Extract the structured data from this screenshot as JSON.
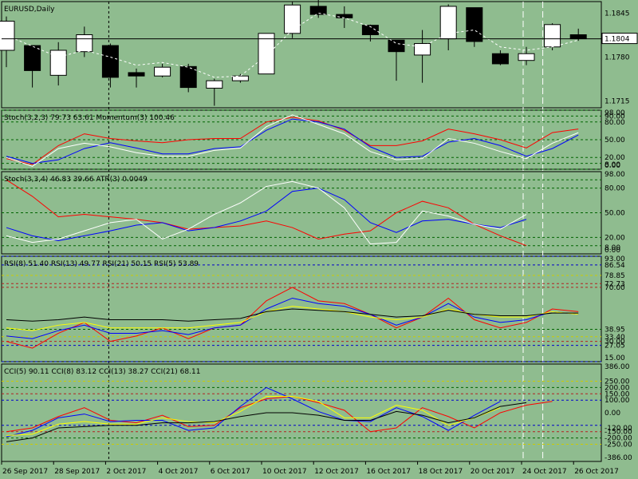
{
  "colors": {
    "background": "#8fbc8f",
    "frame": "#000000",
    "candle_bull": "#ffffff",
    "candle_bear": "#000000",
    "line_red": "#ff0000",
    "line_blue": "#0000ff",
    "line_white": "#ffffff",
    "line_yellow": "#ffff00",
    "line_black": "#000000",
    "level_green": "#006400",
    "level_blue": "#0000cd",
    "level_red": "#b22222",
    "level_yellow": "#cccc00"
  },
  "chart_data": [
    {
      "type": "candlestick",
      "title": "EURUSD,Daily",
      "price_label": "1.1804",
      "ylim": [
        1.1705,
        1.1862
      ],
      "y_ticks": [
        "1.1845",
        "1.1804",
        "1.1780",
        "1.1715"
      ],
      "y_tick_values": [
        1.1845,
        1.1804,
        1.178,
        1.1715
      ],
      "candles": [
        {
          "o": 1.179,
          "h": 1.184,
          "l": 1.1765,
          "c": 1.1833
        },
        {
          "o": 1.1797,
          "h": 1.1795,
          "l": 1.1735,
          "c": 1.176
        },
        {
          "o": 1.1753,
          "h": 1.1802,
          "l": 1.1738,
          "c": 1.179
        },
        {
          "o": 1.1788,
          "h": 1.1825,
          "l": 1.178,
          "c": 1.1813
        },
        {
          "o": 1.1797,
          "h": 1.18,
          "l": 1.1735,
          "c": 1.175
        },
        {
          "o": 1.1757,
          "h": 1.1763,
          "l": 1.1735,
          "c": 1.1752
        },
        {
          "o": 1.1752,
          "h": 1.177,
          "l": 1.175,
          "c": 1.1765
        },
        {
          "o": 1.1766,
          "h": 1.177,
          "l": 1.1728,
          "c": 1.1735
        },
        {
          "o": 1.1734,
          "h": 1.1748,
          "l": 1.1708,
          "c": 1.1745
        },
        {
          "o": 1.1745,
          "h": 1.1755,
          "l": 1.1742,
          "c": 1.1752
        },
        {
          "o": 1.1755,
          "h": 1.1815,
          "l": 1.1755,
          "c": 1.1815
        },
        {
          "o": 1.1815,
          "h": 1.1862,
          "l": 1.1808,
          "c": 1.1857
        },
        {
          "o": 1.1855,
          "h": 1.1865,
          "l": 1.1838,
          "c": 1.1843
        },
        {
          "o": 1.1843,
          "h": 1.1855,
          "l": 1.1823,
          "c": 1.1838
        },
        {
          "o": 1.1827,
          "h": 1.1828,
          "l": 1.1803,
          "c": 1.1813
        },
        {
          "o": 1.1805,
          "h": 1.1805,
          "l": 1.1745,
          "c": 1.1788
        },
        {
          "o": 1.1783,
          "h": 1.182,
          "l": 1.1742,
          "c": 1.18
        },
        {
          "o": 1.1807,
          "h": 1.1858,
          "l": 1.179,
          "c": 1.1855
        },
        {
          "o": 1.1853,
          "h": 1.1853,
          "l": 1.1795,
          "c": 1.1803
        },
        {
          "o": 1.1785,
          "h": 1.179,
          "l": 1.1768,
          "c": 1.177
        },
        {
          "o": 1.1775,
          "h": 1.1795,
          "l": 1.1768,
          "c": 1.1785
        },
        {
          "o": 1.1795,
          "h": 1.183,
          "l": 1.179,
          "c": 1.1828
        },
        {
          "o": 1.1813,
          "h": 1.1822,
          "l": 1.1804,
          "c": 1.1807
        }
      ],
      "overlay_white_dashed": [
        1.1812,
        1.1796,
        1.178,
        1.179,
        1.178,
        1.1768,
        1.1772,
        1.1765,
        1.175,
        1.1752,
        1.1782,
        1.182,
        1.1845,
        1.1838,
        1.1825,
        1.18,
        1.1795,
        1.1815,
        1.182,
        1.1795,
        1.179,
        1.1795,
        1.1805
      ]
    },
    {
      "type": "line",
      "label": "Stoch(3,2,3) 79.73 63.61 Momentum(3) 100.46",
      "ylim": [
        0,
        100
      ],
      "levels": [
        {
          "v": 100,
          "c": "green"
        },
        {
          "v": 90,
          "c": "green"
        },
        {
          "v": 80,
          "c": "green"
        },
        {
          "v": 50,
          "c": "green"
        },
        {
          "v": 20,
          "c": "green"
        },
        {
          "v": 10,
          "c": "green"
        },
        {
          "v": 0,
          "c": "green"
        }
      ],
      "tick_labels": [
        "98.00",
        "90.00",
        "80.00",
        "50.00",
        "20.00",
        "8.00",
        "0.00"
      ],
      "tick_values": [
        98,
        90,
        80,
        50,
        20,
        8,
        0
      ],
      "series": [
        {
          "color": "red",
          "values": [
            18,
            8,
            40,
            60,
            52,
            48,
            45,
            50,
            52,
            52,
            80,
            88,
            82,
            66,
            40,
            40,
            48,
            68,
            60,
            50,
            36,
            62,
            68
          ]
        },
        {
          "color": "blue",
          "values": [
            22,
            10,
            16,
            35,
            45,
            36,
            26,
            26,
            35,
            38,
            66,
            85,
            80,
            68,
            38,
            20,
            22,
            46,
            52,
            40,
            22,
            35,
            58
          ]
        },
        {
          "color": "white",
          "values": [
            20,
            5,
            35,
            44,
            38,
            28,
            22,
            22,
            32,
            36,
            72,
            92,
            76,
            60,
            30,
            16,
            18,
            52,
            44,
            30,
            18,
            44,
            62
          ]
        }
      ]
    },
    {
      "type": "line",
      "label": "Stoch(3,3,4) 46.83 39.66 ATR(3) 0.0049",
      "ylim": [
        0,
        100
      ],
      "levels": [
        {
          "v": 90,
          "c": "green"
        },
        {
          "v": 80,
          "c": "green"
        },
        {
          "v": 50,
          "c": "green"
        },
        {
          "v": 20,
          "c": "green"
        },
        {
          "v": 10,
          "c": "green"
        }
      ],
      "tick_labels": [
        "98.00",
        "80.00",
        "50.00",
        "20.00",
        "8.00",
        "0.00"
      ],
      "tick_values": [
        98,
        80,
        50,
        20,
        8,
        0
      ],
      "series": [
        {
          "color": "red",
          "values": [
            90,
            70,
            45,
            48,
            45,
            42,
            38,
            30,
            32,
            34,
            40,
            32,
            18,
            24,
            28,
            50,
            64,
            56,
            36,
            22,
            10
          ]
        },
        {
          "color": "blue",
          "values": [
            32,
            22,
            16,
            22,
            28,
            35,
            38,
            28,
            32,
            40,
            52,
            76,
            80,
            66,
            38,
            26,
            40,
            42,
            36,
            32,
            42
          ]
        },
        {
          "color": "white",
          "values": [
            22,
            14,
            18,
            28,
            38,
            42,
            18,
            30,
            48,
            62,
            82,
            88,
            80,
            56,
            12,
            14,
            52,
            46,
            36,
            30,
            48
          ]
        }
      ]
    },
    {
      "type": "line",
      "label": "RSI(8) 51.40 RSI(13) 49.77 RSI(21) 50.15 RSI(5) 53.89",
      "ylim": [
        15,
        93
      ],
      "levels": [
        {
          "v": 93,
          "c": "blue"
        },
        {
          "v": 86.54,
          "c": "blue"
        },
        {
          "v": 78.85,
          "c": "yellow"
        },
        {
          "v": 72.73,
          "c": "red"
        },
        {
          "v": 70,
          "c": "red"
        },
        {
          "v": 38.95,
          "c": "green"
        },
        {
          "v": 33.46,
          "c": "yellow"
        },
        {
          "v": 30,
          "c": "red"
        },
        {
          "v": 27.05,
          "c": "blue"
        },
        {
          "v": 15,
          "c": "blue"
        }
      ],
      "tick_labels": [
        "93.00",
        "86.54",
        "78.85",
        "72.73",
        "70.00",
        "38.95",
        "33.40",
        "30.00",
        "27.05",
        "15.00"
      ],
      "tick_values": [
        93,
        86.54,
        78.85,
        72.73,
        70,
        38.95,
        33.4,
        30,
        27.05,
        15
      ],
      "series": [
        {
          "color": "red",
          "values": [
            30,
            25,
            36,
            44,
            30,
            34,
            40,
            32,
            40,
            42,
            60,
            70,
            60,
            58,
            50,
            40,
            48,
            62,
            46,
            40,
            44,
            54,
            52
          ]
        },
        {
          "color": "blue",
          "values": [
            34,
            32,
            38,
            42,
            36,
            36,
            38,
            35,
            40,
            42,
            54,
            62,
            58,
            56,
            50,
            42,
            48,
            58,
            48,
            44,
            46,
            52,
            50
          ]
        },
        {
          "color": "yellow",
          "values": [
            40,
            38,
            42,
            44,
            40,
            40,
            40,
            40,
            42,
            44,
            52,
            56,
            54,
            52,
            48,
            46,
            48,
            54,
            50,
            48,
            48,
            52,
            50
          ]
        },
        {
          "color": "black",
          "values": [
            46,
            45,
            46,
            48,
            46,
            46,
            46,
            45,
            46,
            47,
            52,
            54,
            53,
            52,
            50,
            48,
            49,
            53,
            50,
            49,
            49,
            51,
            51
          ]
        }
      ]
    },
    {
      "type": "line",
      "label": "CCI(5) 90.11 CCI(8) 83.12 CCI(13) 38.27 CCI(21) 68.11",
      "ylim": [
        -386,
        386
      ],
      "levels": [
        {
          "v": 250,
          "c": "yellow"
        },
        {
          "v": 200,
          "c": "green"
        },
        {
          "v": 150,
          "c": "red"
        },
        {
          "v": 100,
          "c": "blue"
        },
        {
          "v": -100,
          "c": "blue"
        },
        {
          "v": -150,
          "c": "red"
        },
        {
          "v": -200,
          "c": "green"
        },
        {
          "v": -250,
          "c": "yellow"
        }
      ],
      "tick_labels": [
        "386.00",
        "250.00",
        "200.00",
        "150.00",
        "100.00",
        "0.00",
        "-120.00",
        "-150.00",
        "-200.00",
        "-250.00",
        "-386.00"
      ],
      "tick_values": [
        386,
        250,
        200,
        150,
        100,
        0,
        -120,
        -150,
        -200,
        -250,
        -386
      ],
      "series": [
        {
          "color": "red",
          "values": [
            -150,
            -120,
            -30,
            40,
            -60,
            -80,
            -20,
            -110,
            -100,
            40,
            110,
            130,
            80,
            20,
            -150,
            -120,
            40,
            -30,
            -120,
            0,
            60,
            90
          ]
        },
        {
          "color": "blue",
          "values": [
            -190,
            -140,
            -40,
            -10,
            -70,
            -60,
            -60,
            -140,
            -120,
            50,
            200,
            110,
            10,
            -60,
            -70,
            40,
            -30,
            -140,
            -20,
            90
          ]
        },
        {
          "color": "yellow",
          "values": [
            -180,
            -170,
            -90,
            -70,
            -90,
            -90,
            -40,
            -70,
            -80,
            10,
            130,
            130,
            90,
            -40,
            -40,
            60,
            20,
            -100,
            -40,
            40
          ]
        },
        {
          "color": "black",
          "values": [
            -230,
            -200,
            -120,
            -110,
            -100,
            -100,
            -80,
            -80,
            -70,
            -30,
            0,
            0,
            -20,
            -60,
            -60,
            10,
            -20,
            -80,
            -40,
            50,
            80
          ]
        }
      ]
    }
  ],
  "x_axis": {
    "labels": [
      "26 Sep 2017",
      "28 Sep 2017",
      "2 Oct 2017",
      "4 Oct 2017",
      "6 Oct 2017",
      "10 Oct 2017",
      "12 Oct 2017",
      "16 Oct 2017",
      "18 Oct 2017",
      "20 Oct 2017",
      "24 Oct 2017",
      "26 Oct 2017"
    ]
  },
  "markers": {
    "black_dashed_index": 4,
    "white_dashed_indices": [
      20,
      21
    ]
  }
}
